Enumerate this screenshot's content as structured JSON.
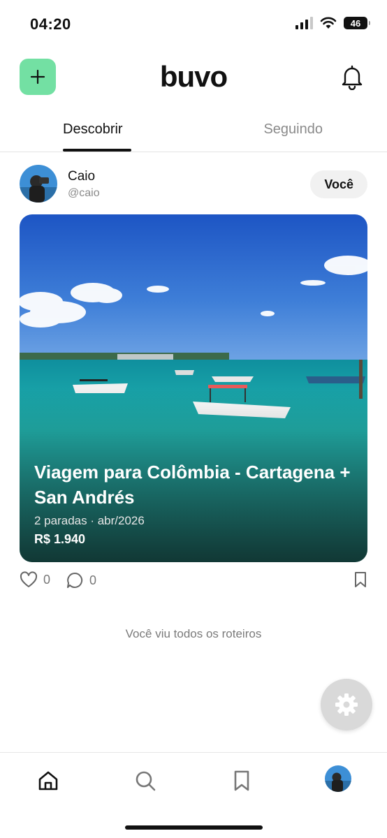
{
  "status_bar": {
    "time": "04:20",
    "battery": "46"
  },
  "header": {
    "brand": "buvo",
    "add_icon": "plus-icon",
    "notification_icon": "bell-icon",
    "accent_color": "#73e0a3"
  },
  "tabs": [
    {
      "label": "Descobrir",
      "active": true
    },
    {
      "label": "Seguindo",
      "active": false
    }
  ],
  "post": {
    "author_name": "Caio",
    "author_handle": "@caio",
    "badge": "Você",
    "title": "Viagem para Colômbia - Cartagena + San Andrés",
    "meta": "2 paradas · abr/2026",
    "price": "R$ 1.940",
    "likes": "0",
    "comments": "0"
  },
  "feed_end": "Você viu todos os roteiros",
  "nav": {
    "items": [
      "home-icon",
      "search-icon",
      "bookmark-icon",
      "profile-avatar"
    ]
  }
}
